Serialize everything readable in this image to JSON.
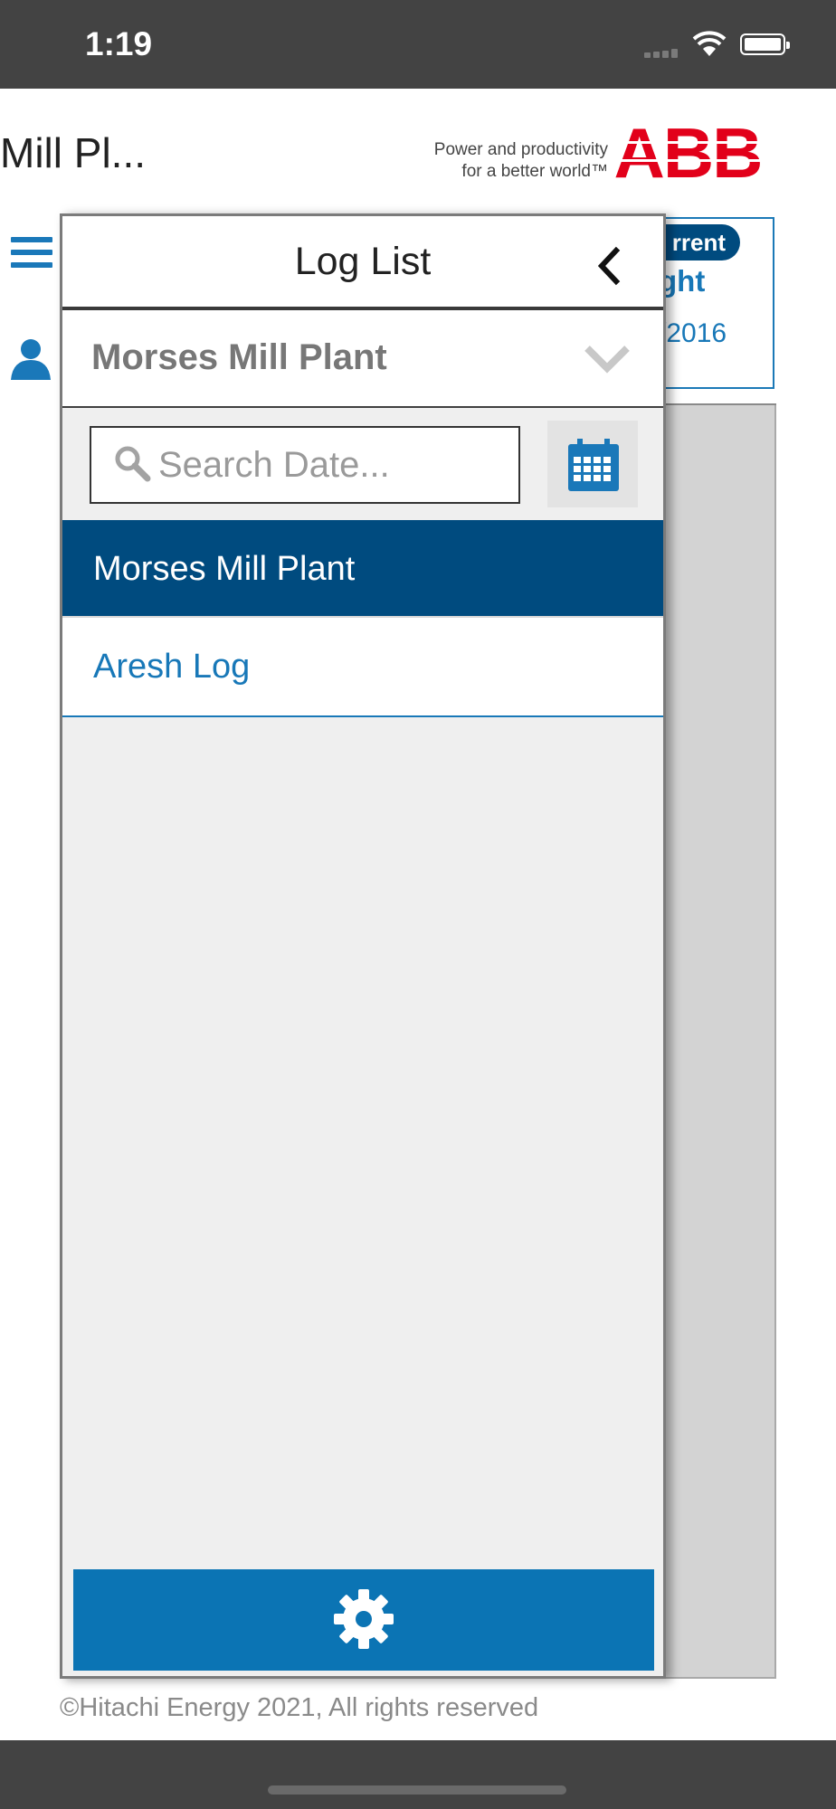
{
  "status_bar": {
    "time": "1:19"
  },
  "header": {
    "title": "Mill Pl...",
    "tagline_line1": "Power and productivity",
    "tagline_line2": "for a better world™",
    "logo_text": "ABB",
    "brand_color": "#e2001a"
  },
  "background_card": {
    "badge": "rrent",
    "title": "ght",
    "date": "/2016"
  },
  "drawer": {
    "title": "Log List",
    "plant_selector": {
      "value": "Morses Mill Plant"
    },
    "search": {
      "placeholder": "Search Date...",
      "value": ""
    },
    "items": [
      {
        "label": "Morses Mill Plant",
        "selected": true
      },
      {
        "label": "Aresh Log",
        "selected": false
      }
    ]
  },
  "footer": {
    "copyright": "©Hitachi Energy 2021, All rights reserved"
  },
  "colors": {
    "accent": "#0b74b4",
    "selected": "#004b7f",
    "link": "#1878b8"
  }
}
